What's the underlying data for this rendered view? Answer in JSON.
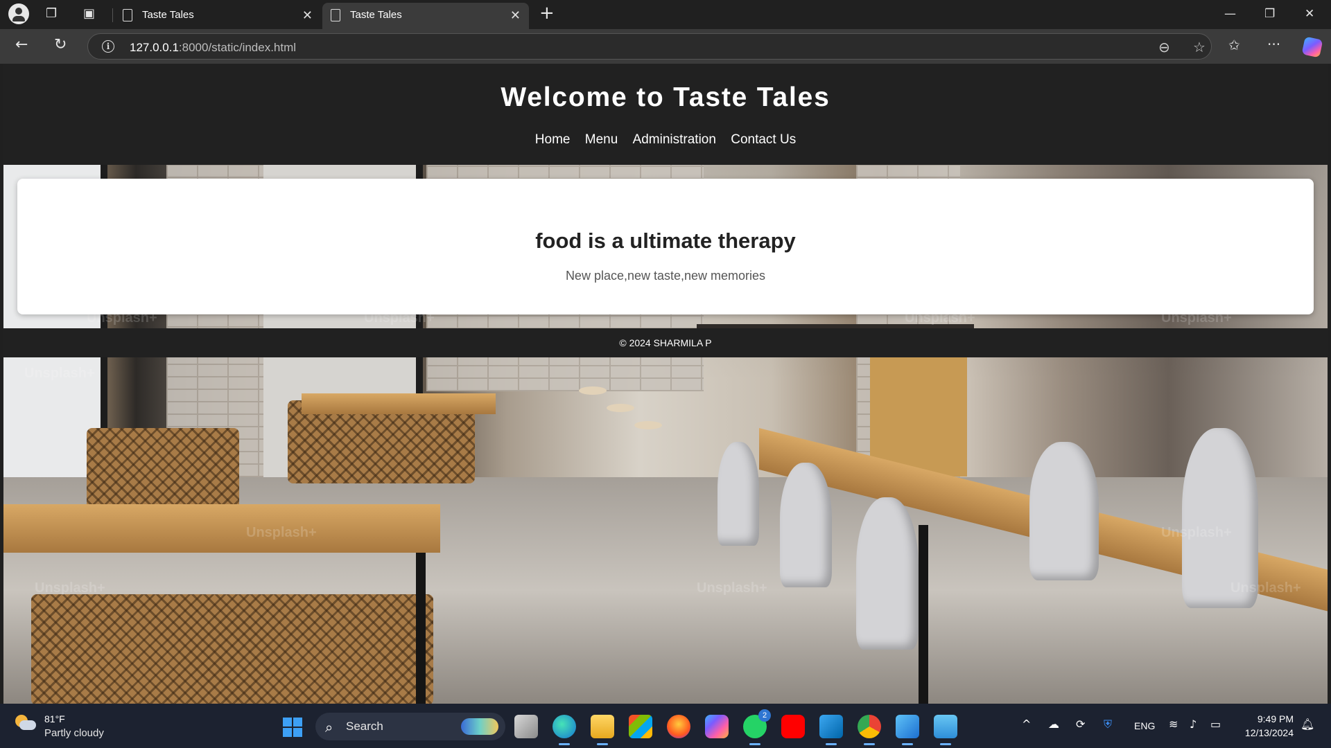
{
  "browser": {
    "tabs": [
      {
        "title": "Taste Tales",
        "active": false
      },
      {
        "title": "Taste Tales",
        "active": true
      }
    ],
    "url_host": "127.0.0.1",
    "url_rest": ":8000/static/index.html"
  },
  "page": {
    "site_title": "Welcome to Taste Tales",
    "nav": [
      "Home",
      "Menu",
      "Administration",
      "Contact Us"
    ],
    "hero_title": "food is a ultimate therapy",
    "hero_subtitle": "New place,new taste,new memories",
    "footer": "© 2024 SHARMILA P",
    "background_watermark": "Unsplash+"
  },
  "taskbar": {
    "weather_temp": "81°F",
    "weather_condition": "Partly cloudy",
    "search_placeholder": "Search",
    "whatsapp_badge": "2",
    "language": "ENG",
    "time": "9:49 PM",
    "date": "12/13/2024"
  },
  "colors": {
    "header_bg": "#212121",
    "taskbar_bg": "#1c2230",
    "chrome_bg": "#202020",
    "active_tab_bg": "#3b3b3b"
  }
}
